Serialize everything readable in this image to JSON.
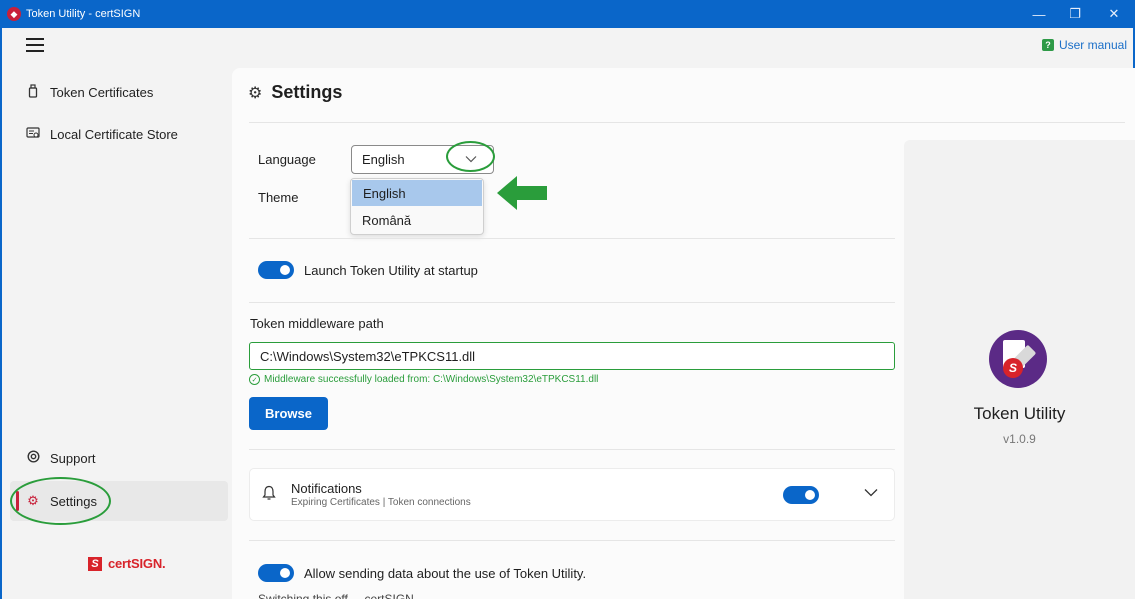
{
  "window": {
    "title": "Token Utility - certSIGN",
    "minimize_glyph": "—",
    "maximize_glyph": "❐",
    "close_glyph": "✕"
  },
  "header": {
    "user_manual_label": "User manual",
    "user_manual_icon": "?"
  },
  "sidebar": {
    "items": [
      {
        "label": "Token Certificates",
        "icon": "usb-token-icon"
      },
      {
        "label": "Local Certificate Store",
        "icon": "certificate-store-icon"
      },
      {
        "label": "Support",
        "icon": "support-icon"
      },
      {
        "label": "Settings",
        "icon": "gear-icon",
        "active": true
      }
    ],
    "brand": "certSIGN."
  },
  "settings": {
    "title": "Settings",
    "language_label": "Language",
    "language_value": "English",
    "language_options": [
      "English",
      "Română"
    ],
    "theme_label": "Theme",
    "launch_at_startup_label": "Launch Token Utility at startup",
    "launch_at_startup_on": true,
    "middleware_label": "Token middleware path",
    "middleware_path": "C:\\Windows\\System32\\eTPKCS11.dll",
    "middleware_status": "Middleware successfully loaded from: C:\\Windows\\System32\\eTPKCS11.dll",
    "browse_label": "Browse",
    "notifications": {
      "title": "Notifications",
      "subtitle": "Expiring Certificates | Token connections",
      "enabled": true
    },
    "telemetry_label": "Allow sending data about the use of Token Utility.",
    "telemetry_on": true,
    "telemetry_note_partial": "Switching this off ... certSIGN"
  },
  "about": {
    "app_name": "Token Utility",
    "version": "v1.0.9"
  },
  "colors": {
    "accent": "#0a66c9",
    "brand_red": "#d8232a",
    "annotation_green": "#2a9d3b",
    "success_green": "#2a9d3b"
  }
}
